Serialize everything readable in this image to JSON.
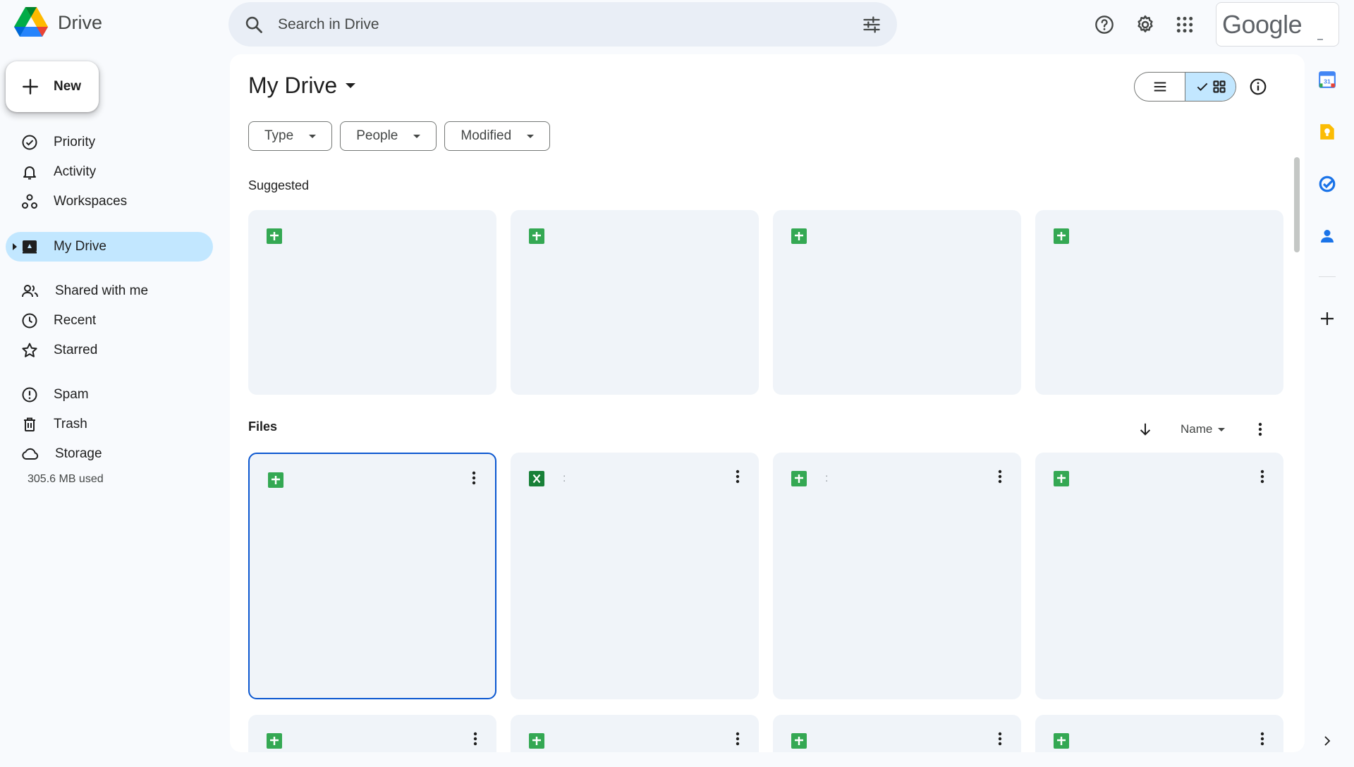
{
  "app": {
    "name": "Drive"
  },
  "search": {
    "placeholder": "Search in Drive"
  },
  "account": {
    "logo_text": "Google"
  },
  "sidebar": {
    "new_label": "New",
    "items": [
      {
        "label": "Priority",
        "icon": "priority-icon"
      },
      {
        "label": "Activity",
        "icon": "bell-icon"
      },
      {
        "label": "Workspaces",
        "icon": "workspaces-icon"
      },
      {
        "label": "My Drive",
        "icon": "my-drive-icon",
        "active": true
      },
      {
        "label": "Shared with me",
        "icon": "people-icon"
      },
      {
        "label": "Recent",
        "icon": "clock-icon"
      },
      {
        "label": "Starred",
        "icon": "star-icon"
      },
      {
        "label": "Spam",
        "icon": "spam-icon"
      },
      {
        "label": "Trash",
        "icon": "trash-icon"
      },
      {
        "label": "Storage",
        "icon": "cloud-icon"
      }
    ],
    "storage_used": "305.6 MB used"
  },
  "main": {
    "title": "My Drive",
    "filters": [
      {
        "label": "Type"
      },
      {
        "label": "People"
      },
      {
        "label": "Modified"
      }
    ],
    "suggested_label": "Suggested",
    "files_label": "Files",
    "sort_label": "Name",
    "suggested_cards": [
      {
        "type": "sheets"
      },
      {
        "type": "sheets"
      },
      {
        "type": "sheets"
      },
      {
        "type": "sheets"
      }
    ],
    "file_cards": [
      {
        "type": "sheets",
        "name": "",
        "selected": true
      },
      {
        "type": "excel",
        "name": ":"
      },
      {
        "type": "sheets",
        "name": ":"
      },
      {
        "type": "sheets",
        "name": ""
      },
      {
        "type": "sheets",
        "name": ""
      },
      {
        "type": "sheets",
        "name": ""
      },
      {
        "type": "sheets",
        "name": ""
      },
      {
        "type": "sheets",
        "name": ""
      }
    ]
  },
  "colors": {
    "accent": "#0b57d0",
    "selected_nav": "#c2e7ff",
    "sheets_green": "#34a853",
    "excel_green": "#188038"
  },
  "right_rail": [
    {
      "icon": "calendar-icon",
      "label": "31"
    },
    {
      "icon": "keep-icon"
    },
    {
      "icon": "tasks-icon"
    },
    {
      "icon": "contacts-icon"
    },
    {
      "icon": "add-icon"
    }
  ]
}
